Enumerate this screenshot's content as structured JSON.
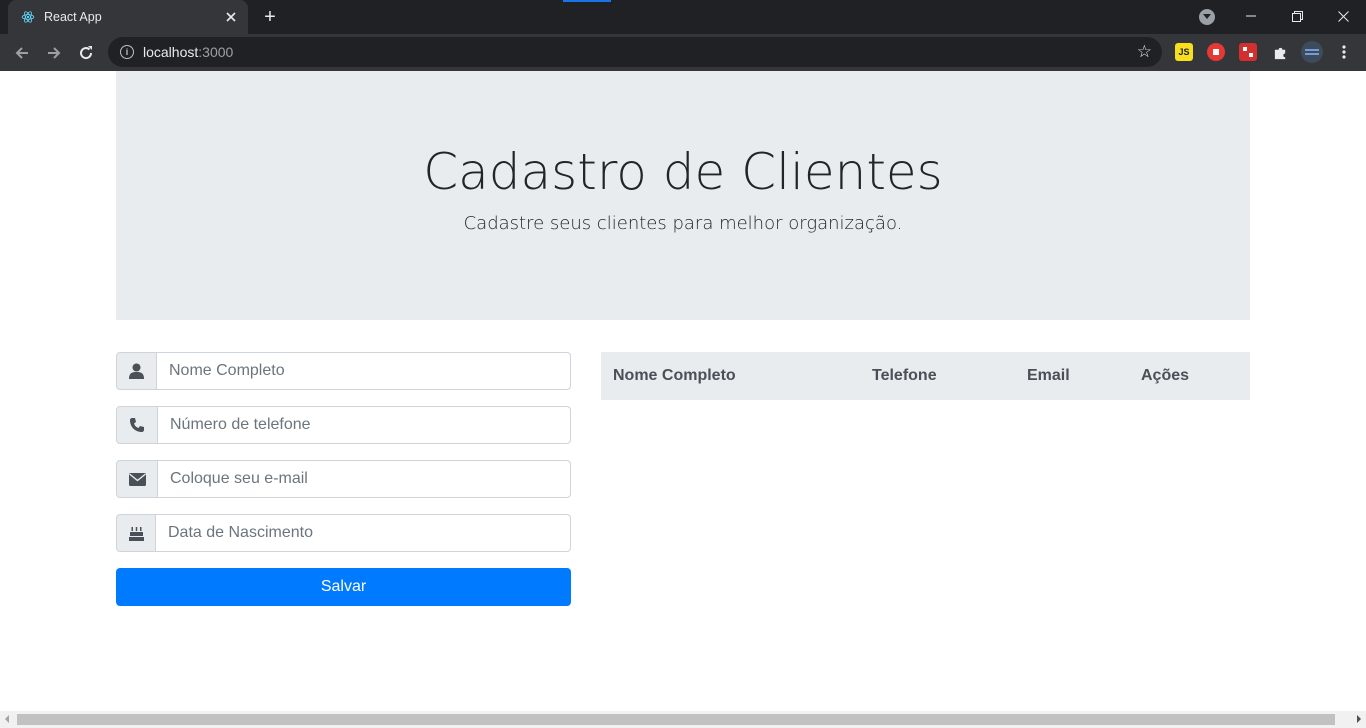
{
  "browser": {
    "tab_title": "React App",
    "url_host": "localhost",
    "url_port": ":3000",
    "new_tab_symbol": "+",
    "icons": {
      "favicon": "react-icon",
      "back": "arrow-left-icon",
      "forward": "arrow-right-icon",
      "reload": "reload-icon",
      "site_info": "info-icon",
      "bookmark": "star-icon",
      "extensions": "puzzle-icon",
      "menu": "kebab-menu-icon"
    },
    "extensions": [
      {
        "name": "js-extension",
        "label": "JS",
        "color": "#f7df1e"
      },
      {
        "name": "adblock-extension",
        "label": "",
        "color": "#e53935"
      },
      {
        "name": "red-extension",
        "label": "",
        "color": "#d32f2f"
      }
    ]
  },
  "jumbotron": {
    "title": "Cadastro de Clientes",
    "subtitle": "Cadastre seus clientes para melhor organização."
  },
  "form": {
    "fields": [
      {
        "icon": "user-icon",
        "placeholder": "Nome Completo",
        "value": ""
      },
      {
        "icon": "phone-icon",
        "placeholder": "Número de telefone",
        "value": ""
      },
      {
        "icon": "envelope-icon",
        "placeholder": "Coloque seu e-mail",
        "value": ""
      },
      {
        "icon": "birthday-cake-icon",
        "placeholder": "Data de Nascimento",
        "value": ""
      }
    ],
    "submit_label": "Salvar"
  },
  "table": {
    "headers": [
      "Nome Completo",
      "Telefone",
      "Email",
      "Ações"
    ],
    "rows": []
  },
  "colors": {
    "primary": "#007bff",
    "jumbotron_bg": "#e9ecef",
    "chrome_dark": "#202124",
    "chrome_toolbar": "#35363a"
  }
}
